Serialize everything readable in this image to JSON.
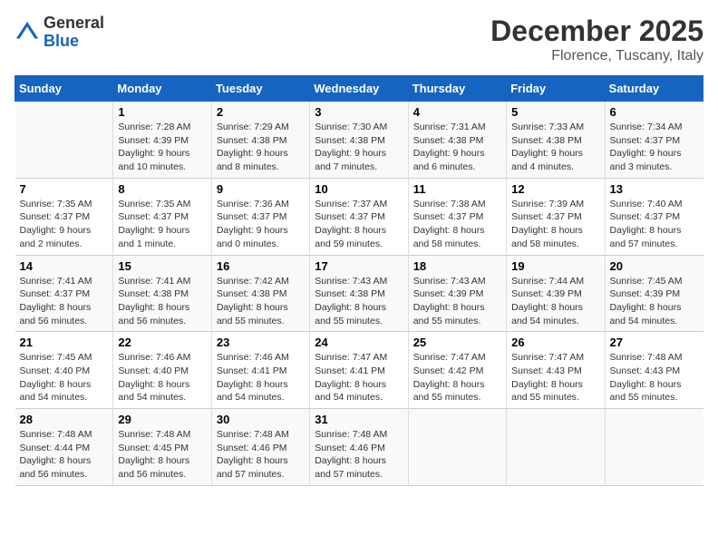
{
  "header": {
    "logo_general": "General",
    "logo_blue": "Blue",
    "month_title": "December 2025",
    "location": "Florence, Tuscany, Italy"
  },
  "weekdays": [
    "Sunday",
    "Monday",
    "Tuesday",
    "Wednesday",
    "Thursday",
    "Friday",
    "Saturday"
  ],
  "weeks": [
    [
      {
        "day": "",
        "info": ""
      },
      {
        "day": "1",
        "info": "Sunrise: 7:28 AM\nSunset: 4:39 PM\nDaylight: 9 hours\nand 10 minutes."
      },
      {
        "day": "2",
        "info": "Sunrise: 7:29 AM\nSunset: 4:38 PM\nDaylight: 9 hours\nand 8 minutes."
      },
      {
        "day": "3",
        "info": "Sunrise: 7:30 AM\nSunset: 4:38 PM\nDaylight: 9 hours\nand 7 minutes."
      },
      {
        "day": "4",
        "info": "Sunrise: 7:31 AM\nSunset: 4:38 PM\nDaylight: 9 hours\nand 6 minutes."
      },
      {
        "day": "5",
        "info": "Sunrise: 7:33 AM\nSunset: 4:38 PM\nDaylight: 9 hours\nand 4 minutes."
      },
      {
        "day": "6",
        "info": "Sunrise: 7:34 AM\nSunset: 4:37 PM\nDaylight: 9 hours\nand 3 minutes."
      }
    ],
    [
      {
        "day": "7",
        "info": "Sunrise: 7:35 AM\nSunset: 4:37 PM\nDaylight: 9 hours\nand 2 minutes."
      },
      {
        "day": "8",
        "info": "Sunrise: 7:35 AM\nSunset: 4:37 PM\nDaylight: 9 hours\nand 1 minute."
      },
      {
        "day": "9",
        "info": "Sunrise: 7:36 AM\nSunset: 4:37 PM\nDaylight: 9 hours\nand 0 minutes."
      },
      {
        "day": "10",
        "info": "Sunrise: 7:37 AM\nSunset: 4:37 PM\nDaylight: 8 hours\nand 59 minutes."
      },
      {
        "day": "11",
        "info": "Sunrise: 7:38 AM\nSunset: 4:37 PM\nDaylight: 8 hours\nand 58 minutes."
      },
      {
        "day": "12",
        "info": "Sunrise: 7:39 AM\nSunset: 4:37 PM\nDaylight: 8 hours\nand 58 minutes."
      },
      {
        "day": "13",
        "info": "Sunrise: 7:40 AM\nSunset: 4:37 PM\nDaylight: 8 hours\nand 57 minutes."
      }
    ],
    [
      {
        "day": "14",
        "info": "Sunrise: 7:41 AM\nSunset: 4:37 PM\nDaylight: 8 hours\nand 56 minutes."
      },
      {
        "day": "15",
        "info": "Sunrise: 7:41 AM\nSunset: 4:38 PM\nDaylight: 8 hours\nand 56 minutes."
      },
      {
        "day": "16",
        "info": "Sunrise: 7:42 AM\nSunset: 4:38 PM\nDaylight: 8 hours\nand 55 minutes."
      },
      {
        "day": "17",
        "info": "Sunrise: 7:43 AM\nSunset: 4:38 PM\nDaylight: 8 hours\nand 55 minutes."
      },
      {
        "day": "18",
        "info": "Sunrise: 7:43 AM\nSunset: 4:39 PM\nDaylight: 8 hours\nand 55 minutes."
      },
      {
        "day": "19",
        "info": "Sunrise: 7:44 AM\nSunset: 4:39 PM\nDaylight: 8 hours\nand 54 minutes."
      },
      {
        "day": "20",
        "info": "Sunrise: 7:45 AM\nSunset: 4:39 PM\nDaylight: 8 hours\nand 54 minutes."
      }
    ],
    [
      {
        "day": "21",
        "info": "Sunrise: 7:45 AM\nSunset: 4:40 PM\nDaylight: 8 hours\nand 54 minutes."
      },
      {
        "day": "22",
        "info": "Sunrise: 7:46 AM\nSunset: 4:40 PM\nDaylight: 8 hours\nand 54 minutes."
      },
      {
        "day": "23",
        "info": "Sunrise: 7:46 AM\nSunset: 4:41 PM\nDaylight: 8 hours\nand 54 minutes."
      },
      {
        "day": "24",
        "info": "Sunrise: 7:47 AM\nSunset: 4:41 PM\nDaylight: 8 hours\nand 54 minutes."
      },
      {
        "day": "25",
        "info": "Sunrise: 7:47 AM\nSunset: 4:42 PM\nDaylight: 8 hours\nand 55 minutes."
      },
      {
        "day": "26",
        "info": "Sunrise: 7:47 AM\nSunset: 4:43 PM\nDaylight: 8 hours\nand 55 minutes."
      },
      {
        "day": "27",
        "info": "Sunrise: 7:48 AM\nSunset: 4:43 PM\nDaylight: 8 hours\nand 55 minutes."
      }
    ],
    [
      {
        "day": "28",
        "info": "Sunrise: 7:48 AM\nSunset: 4:44 PM\nDaylight: 8 hours\nand 56 minutes."
      },
      {
        "day": "29",
        "info": "Sunrise: 7:48 AM\nSunset: 4:45 PM\nDaylight: 8 hours\nand 56 minutes."
      },
      {
        "day": "30",
        "info": "Sunrise: 7:48 AM\nSunset: 4:46 PM\nDaylight: 8 hours\nand 57 minutes."
      },
      {
        "day": "31",
        "info": "Sunrise: 7:48 AM\nSunset: 4:46 PM\nDaylight: 8 hours\nand 57 minutes."
      },
      {
        "day": "",
        "info": ""
      },
      {
        "day": "",
        "info": ""
      },
      {
        "day": "",
        "info": ""
      }
    ]
  ]
}
